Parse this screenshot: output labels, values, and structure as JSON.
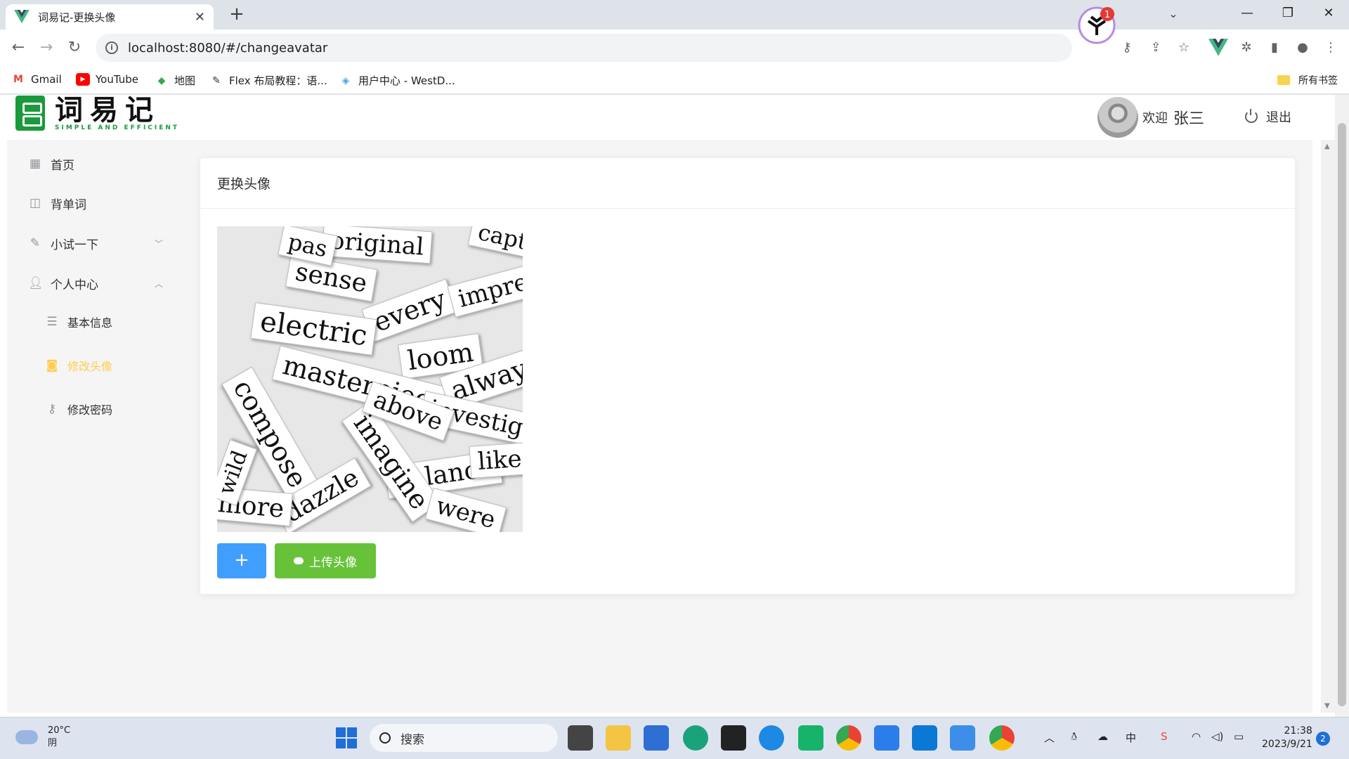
{
  "browser": {
    "tab_title": "词易记-更换头像",
    "url": "localhost:8080/#/changeavatar",
    "extension_badge": "1",
    "bookmarks": [
      "Gmail",
      "YouTube",
      "地图",
      "Flex 布局教程：语...",
      "用户中心 - WestD..."
    ],
    "all_bookmarks": "所有书签"
  },
  "header": {
    "logo_title": "词易记",
    "logo_sub": "SIMPLE AND EFFICIENT",
    "welcome": "欢迎",
    "username": "张三",
    "logout": "退出"
  },
  "sidebar": {
    "items": [
      {
        "label": "首页",
        "icon": "grid-icon"
      },
      {
        "label": "背单词",
        "icon": "book-icon"
      },
      {
        "label": "小试一下",
        "icon": "pencil-icon"
      },
      {
        "label": "个人中心",
        "icon": "user-icon"
      }
    ],
    "sub_items": [
      {
        "label": "基本信息",
        "icon": "sliders-icon"
      },
      {
        "label": "修改头像",
        "icon": "camera-icon",
        "active": true
      },
      {
        "label": "修改密码",
        "icon": "key-icon"
      }
    ],
    "active_color": "#ffcd4d"
  },
  "card": {
    "title": "更换头像",
    "image_words": [
      "original",
      "sense",
      "every",
      "electric",
      "loom",
      "masterpiece",
      "always",
      "compose",
      "investig",
      "balance",
      "imagine",
      "dazzle",
      "above",
      "were",
      "more",
      "like",
      "impressio",
      "captu",
      "pas",
      "wild"
    ],
    "plus_label": "+",
    "upload_label": "上传头像"
  },
  "taskbar": {
    "temperature": "20°C",
    "weather": "阴",
    "search_placeholder": "搜索",
    "time": "21:38",
    "date": "2023/9/21",
    "notifications": "2"
  },
  "colors": {
    "primary": "#409eff",
    "success": "#67c23a",
    "brand_green": "#1a9a3c"
  }
}
